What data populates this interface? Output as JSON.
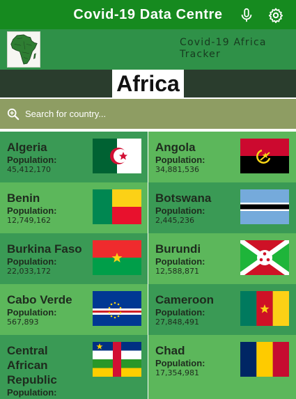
{
  "app": {
    "title": "Covid-19 Data Centre",
    "mic_icon": "microphone-icon",
    "settings_icon": "gear-icon"
  },
  "banner": {
    "tracker_line1": "Covid-19 Africa",
    "tracker_line2": "Tracker",
    "map_icon": "africa-map-icon"
  },
  "region": {
    "title": "Africa"
  },
  "search": {
    "placeholder": "Search for country...",
    "icon": "search-icon"
  },
  "colors": {
    "appbar": "#168a1f",
    "banner": "#2f9148",
    "card_dark": "#3a9a55",
    "card_light": "#5cb75b",
    "search": "#8e9d63",
    "region_bar": "#2a3d2d"
  },
  "population_label": "Population:",
  "countries": [
    {
      "name": "Algeria",
      "population": "45,412,170",
      "flag": "algeria-flag"
    },
    {
      "name": "Angola",
      "population": "34,881,536",
      "flag": "angola-flag"
    },
    {
      "name": "Benin",
      "population": "12,749,162",
      "flag": "benin-flag"
    },
    {
      "name": "Botswana",
      "population": "2,445,236",
      "flag": "botswana-flag"
    },
    {
      "name": "Burkina Faso",
      "population": "22,033,172",
      "flag": "burkina-faso-flag"
    },
    {
      "name": "Burundi",
      "population": "12,588,871",
      "flag": "burundi-flag"
    },
    {
      "name": "Cabo Verde",
      "population": "567,893",
      "flag": "cabo-verde-flag"
    },
    {
      "name": "Cameroon",
      "population": "27,848,491",
      "flag": "cameroon-flag"
    },
    {
      "name": "Central African Republic",
      "population": "",
      "flag": "central-african-republic-flag"
    },
    {
      "name": "Chad",
      "population": "17,354,981",
      "flag": "chad-flag"
    }
  ]
}
